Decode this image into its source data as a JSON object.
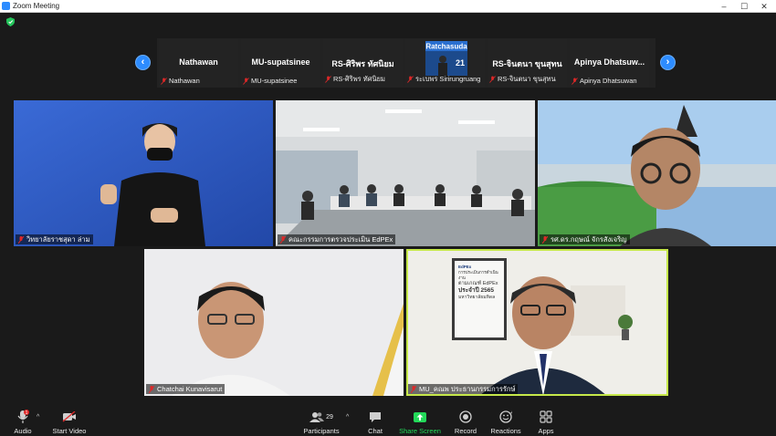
{
  "window": {
    "title": "Zoom Meeting"
  },
  "strip": {
    "prev_label": "‹",
    "next_label": "›",
    "tiles": [
      {
        "name": "Nathawan",
        "label": "Nathawan"
      },
      {
        "name": "MU-supatsinee",
        "label": "MU-supatsinee"
      },
      {
        "name": "RS-ศิริพร ทัศนิยม",
        "label": "RS-ศิริพร ทัศนิยม"
      },
      {
        "name": "",
        "label": "ระเบพร Sirirungruang"
      },
      {
        "name": "RS-จินตนา ขุนสุทน",
        "label": "RS-จินตนา ขุนสุทน"
      },
      {
        "name": "Apinya  Dhatsuw...",
        "label": "Apinya Dhatsuwan"
      }
    ],
    "logo_text": "Ratchasuda",
    "logo_number": "21"
  },
  "videos": [
    {
      "label": "วิทยาลัยราชสุดา ล่าม"
    },
    {
      "label": "คณะกรรมการตรวจประเมิน EdPEx"
    },
    {
      "label": "รศ.ดร.กฤษณ์ จักรสังเจริญ"
    },
    {
      "label": "Chatchai Kunavisarut"
    },
    {
      "label": "MU_คณพ ประธานกรรมการรักษ์"
    }
  ],
  "poster": {
    "brand": "EdPEx",
    "line1": "การประเมินการดำเนินงาน",
    "line2": "ตามเกณฑ์ EdPEx",
    "line3": "ประจำปี 2565",
    "line4": "มหาวิทยาลัยมหิดล"
  },
  "toolbar": {
    "audio": "Audio",
    "start_video": "Start Video",
    "participants": "Participants",
    "participants_count": "29",
    "chat": "Chat",
    "share_screen": "Share Screen",
    "record": "Record",
    "reactions": "Reactions",
    "apps": "Apps",
    "audio_badge": "1"
  },
  "colors": {
    "accent": "#2d8cff",
    "share": "#23d959",
    "speaker_border": "#c6e84a",
    "mute": "#e02828"
  }
}
